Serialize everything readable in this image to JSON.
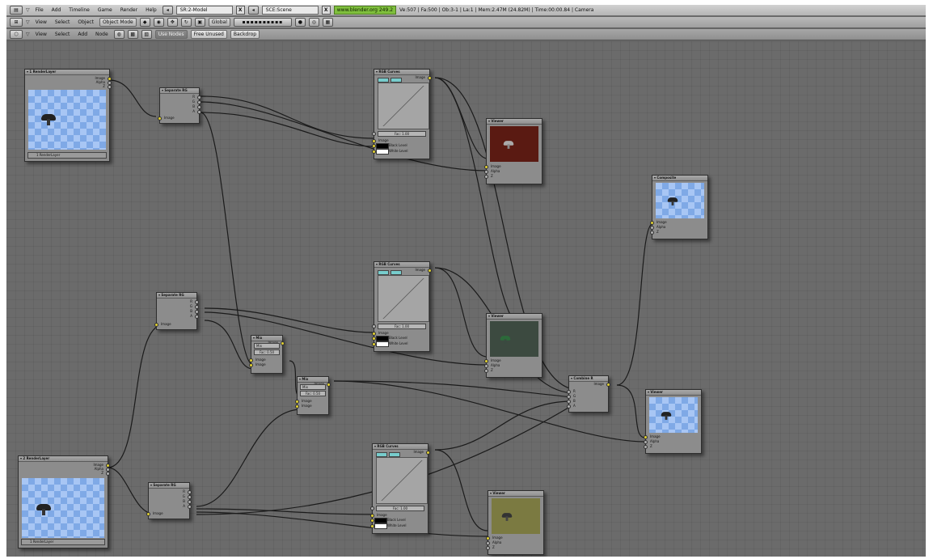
{
  "header": {
    "menus": [
      "File",
      "Add",
      "Timeline",
      "Game",
      "Render",
      "Help"
    ],
    "screen_field": "SR:2-Model",
    "scene_field": "SCE:Scene",
    "url": "www.blender.org 249.2",
    "stats": "Ve:507 | Fa:500 | Ob:3-1 | La:1  | Mem:2.47M (24.82M)  | Time:00:00.84 | Camera"
  },
  "toolbar3d": {
    "menus": [
      "View",
      "Select",
      "Object"
    ],
    "mode": "Object Mode",
    "orientation": "Global"
  },
  "nodebar": {
    "menus": [
      "View",
      "Select",
      "Add",
      "Node"
    ],
    "use_nodes": "Use Nodes",
    "free_unused": "Free Unused",
    "backdrop": "Backdrop"
  },
  "nodes": {
    "rl1": {
      "title": "1 RenderLayer",
      "outputs": [
        "Image",
        "Alpha",
        "Z"
      ],
      "layer": "1 RenderLayer"
    },
    "rl2": {
      "title": "2 RenderLayer",
      "outputs": [
        "Image",
        "Alpha",
        "Z"
      ],
      "layer": "1 RenderLayer"
    },
    "sep1": {
      "title": "Separate RG",
      "outputs": [
        "R",
        "G",
        "B",
        "A"
      ],
      "input": "Image"
    },
    "sep2": {
      "title": "Separate RG",
      "outputs": [
        "R",
        "G",
        "B",
        "A"
      ],
      "input": "Image"
    },
    "sep3": {
      "title": "Separate RG",
      "outputs": [
        "R",
        "G",
        "B",
        "A"
      ],
      "input": "Image"
    },
    "curves1": {
      "title": "RGB Curves",
      "output": "Image",
      "fac": "Fac: 1.00",
      "inputs": [
        "Image",
        "Black Level",
        "White Level"
      ]
    },
    "curves2": {
      "title": "RGB Curves",
      "output": "Image",
      "fac": "Fac: 1.00",
      "inputs": [
        "Image",
        "Black Level",
        "White Level"
      ]
    },
    "curves3": {
      "title": "RGB Curves",
      "output": "Image",
      "fac": "Fac: 1.00",
      "inputs": [
        "Image",
        "Black Level",
        "White Level"
      ]
    },
    "viewer1": {
      "title": "Viewer",
      "inputs": [
        "Image",
        "Alpha",
        "Z"
      ]
    },
    "viewer2": {
      "title": "Viewer",
      "inputs": [
        "Image",
        "Alpha",
        "Z"
      ]
    },
    "viewer3": {
      "title": "Viewer",
      "inputs": [
        "Image",
        "Alpha",
        "Z"
      ]
    },
    "viewer4": {
      "title": "Viewer",
      "inputs": [
        "Image",
        "Alpha",
        "Z"
      ]
    },
    "composite": {
      "title": "Composite",
      "inputs": [
        "Image",
        "Alpha",
        "Z"
      ]
    },
    "mix1": {
      "title": "Mix",
      "output": "Image",
      "mode": "Mix",
      "fac": "Fac: 0.50",
      "inputs": [
        "Image",
        "Image"
      ]
    },
    "mix2": {
      "title": "Mix",
      "output": "Image",
      "mode": "Mix",
      "fac": "Fac: 0.50",
      "inputs": [
        "Image",
        "Image"
      ]
    },
    "combine": {
      "title": "Combine R",
      "output": "Image",
      "inputs": [
        "R",
        "G",
        "B",
        "A"
      ]
    }
  }
}
